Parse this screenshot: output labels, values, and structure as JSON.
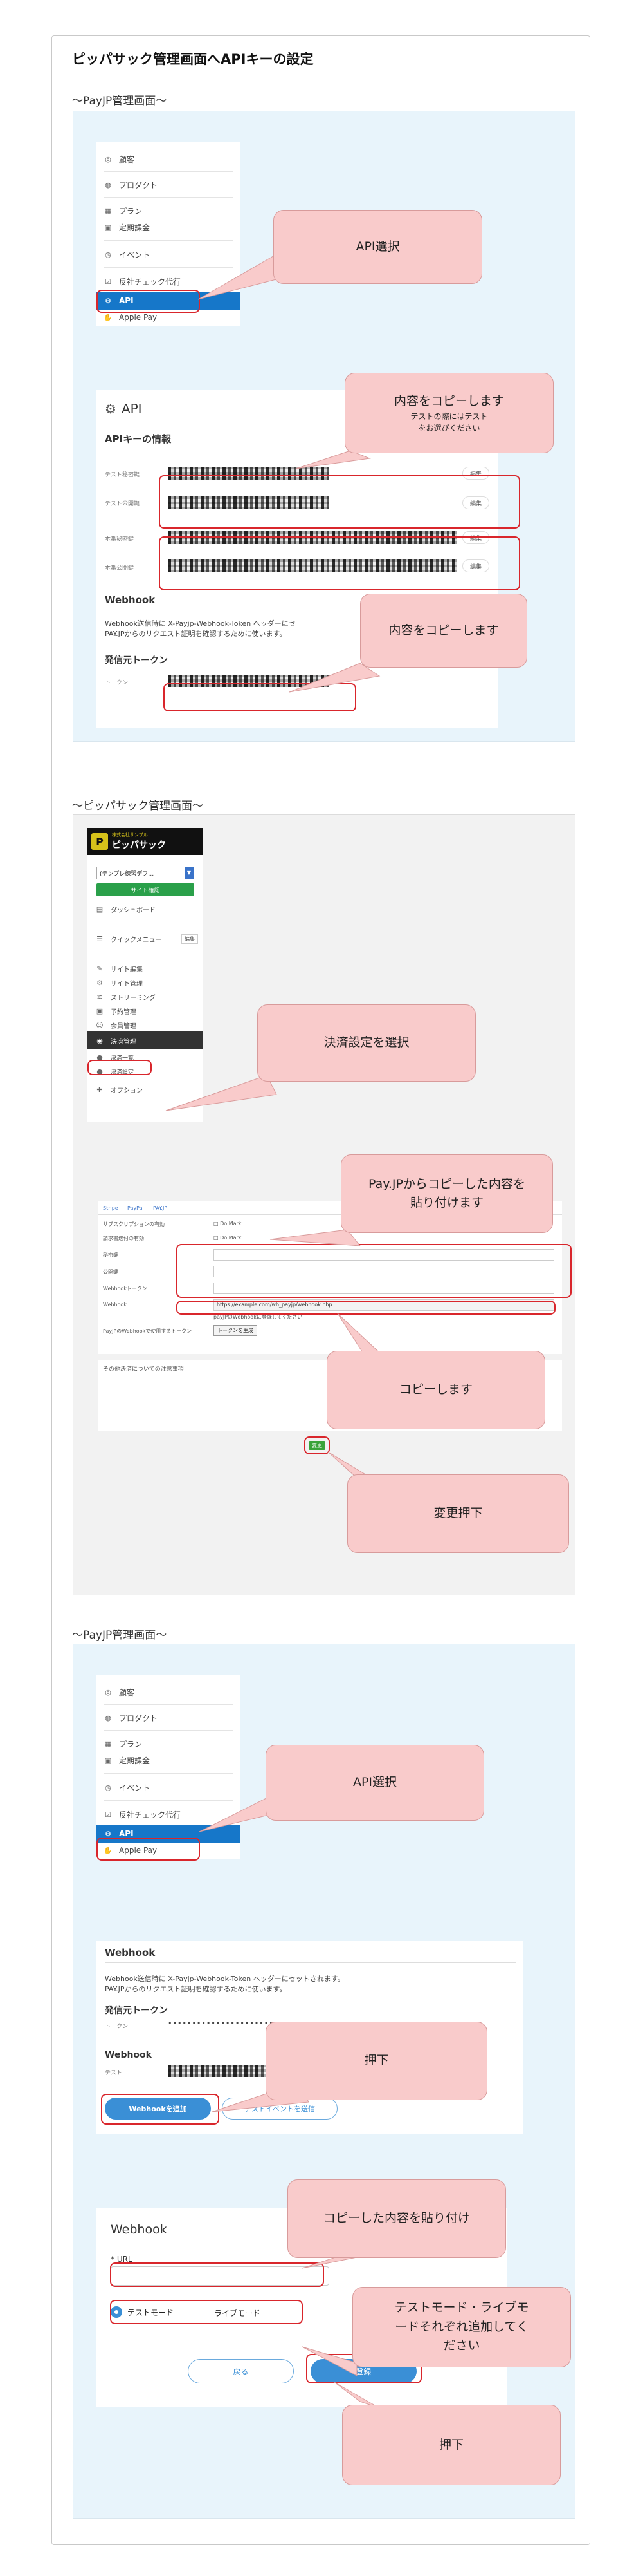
{
  "page_title": "ピッパサック管理画面へAPIキーの設定",
  "sections": {
    "payjp1": "〜PayJP管理画面〜",
    "pippa": "〜ピッパサック管理画面〜",
    "payjp2": "〜PayJP管理画面〜"
  },
  "payjp_menu": {
    "items": [
      "顧客",
      "プロダクト",
      "プラン",
      "定期課金",
      "イベント",
      "反社チェック代行",
      "API",
      "Apple Pay"
    ],
    "icons": [
      "user-icon",
      "box-icon",
      "grid-icon",
      "calendar-icon",
      "clock-icon",
      "check-icon",
      "gear-icon",
      "hand-icon"
    ]
  },
  "api_page": {
    "title": "API",
    "keys_heading": "APIキーの情報",
    "key_labels": [
      "テスト秘密鍵",
      "テスト公開鍵",
      "本番秘密鍵",
      "本番公開鍵"
    ],
    "edit_label": "編集",
    "webhook_heading": "Webhook",
    "webhook_desc_1": "Webhook送信時に X-Payjp-Webhook-Token ヘッダーにセ",
    "webhook_desc_2": "PAY.JPからのリクエスト証明を確認するために使います。",
    "token_heading": "発信元トークン",
    "token_label": "トークン"
  },
  "pippa_menu": {
    "brand": "ピッパサック",
    "brand_sub": "株式会社サンプル",
    "select_value": "(テンプレ練習デフ…",
    "site_confirm": "サイト確認",
    "items": [
      "ダッシュボード",
      "クイックメニュー",
      "サイト編集",
      "サイト管理",
      "ストリーミング",
      "予約管理",
      "会員管理",
      "決済管理",
      "決済一覧",
      "決済設定",
      "オプション"
    ],
    "quick_button": "編集"
  },
  "pippa_settings": {
    "tabs": [
      "Stripe",
      "PayPal",
      "PAY.JP"
    ],
    "row_labels": [
      "サブスクリプションの有効",
      "請求書送付の有効",
      "秘密鍵",
      "公開鍵",
      "Webhookトークン",
      "Webhook",
      "PayJPのWebhookで使用するトークン"
    ],
    "row_values": [
      "□ Do Mark",
      "□ Do Mark"
    ],
    "webhook_url": "https://example.com/wh_payjp/webhook.php",
    "webhook_note": "payJPのWebhookに登録してください",
    "token_button": "トークンを生成",
    "notes_heading": "その他決済についての注意事項",
    "save_button": "変更"
  },
  "payjp_webhook": {
    "heading": "Webhook",
    "desc_1": "Webhook送信時に X-Payjp-Webhook-Token ヘッダーにセットされます。",
    "desc_2": "PAY.JPからのリクエスト証明を確認するために使います。",
    "token_heading": "発信元トークン",
    "token_label": "トークン",
    "token_dots": "••••••••••••••••••••••••••",
    "webhook_heading": "Webhook",
    "test_label": "テスト",
    "add_button": "Webhookを追加",
    "test_event_button": "テストイベントを送信"
  },
  "webhook_modal": {
    "title": "Webhook",
    "url_label": "* URL",
    "mode_test": "テストモード",
    "mode_live": "ライブモード",
    "back": "戻る",
    "register": "登録"
  },
  "bubbles": {
    "api_select_1": "API選択",
    "copy_1_line1": "内容をコピーします",
    "copy_1_line2": "テストの際にはテスト",
    "copy_1_line3": "をお選びください",
    "copy_2": "内容をコピーします",
    "payment_select": "決済設定を選択",
    "paste_line1": "Pay.JPからコピーした内容を",
    "paste_line2": "貼り付けます",
    "copy_3": "コピーします",
    "change_press": "変更押下",
    "api_select_2": "API選択",
    "press_1": "押下",
    "paste_copied": "コピーした内容を貼り付け",
    "modes_line1": "テストモード・ライブモ",
    "modes_line2": "ードそれぞれ追加してく",
    "modes_line3": "ださい",
    "press_2": "押下"
  },
  "colors": {
    "accent_blue": "#1677c9",
    "red_box": "#d9262c",
    "bubble_pink": "#f9cbcb",
    "green": "#3aa33a",
    "panel_blue": "#e8f4fb"
  }
}
